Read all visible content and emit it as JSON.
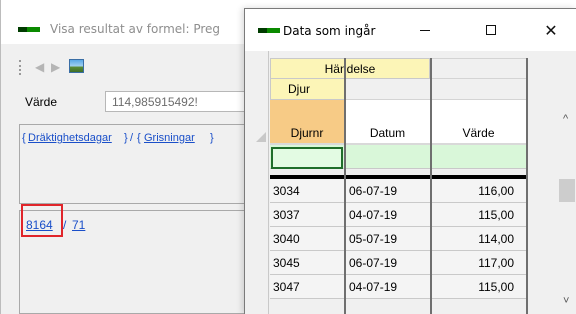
{
  "background_window": {
    "title": "Visa resultat av formel: Preg",
    "toolbar": {
      "back_icon": "arrow-left-icon",
      "forward_icon": "arrow-right-icon",
      "image_icon": "picture-icon"
    },
    "varde_label": "Värde",
    "varde_value": "114,985915492!",
    "formula": {
      "part1": "Dräktighetsdagar",
      "separator": "/",
      "part2": "Grisningar",
      "brace_open": "{",
      "brace_close": "}"
    },
    "result": {
      "numerator": "8164",
      "separator": "/",
      "denominator": "71"
    }
  },
  "data_window": {
    "title": "Data som ingår",
    "caption_buttons": {
      "minimize": "minimize-icon",
      "maximize": "maximize-icon",
      "close": "✕"
    },
    "group_header": "Händelse",
    "sub_header": "Djur",
    "columns": [
      "Djurnr",
      "Datum",
      "Värde"
    ],
    "rows": [
      {
        "djurnr": "3034",
        "datum": "06-07-19",
        "varde": "116,00"
      },
      {
        "djurnr": "3037",
        "datum": "04-07-19",
        "varde": "115,00"
      },
      {
        "djurnr": "3040",
        "datum": "05-07-19",
        "varde": "114,00"
      },
      {
        "djurnr": "3045",
        "datum": "06-07-19",
        "varde": "117,00"
      },
      {
        "djurnr": "3047",
        "datum": "04-07-19",
        "varde": "115,00"
      }
    ],
    "scroll": {
      "up": "^",
      "down": "˅"
    }
  },
  "colors": {
    "app_green": "#0a8a00",
    "header_yellow": "#fcf5b7",
    "header_orange": "#f7cb86",
    "filter_green": "#d9f7d9",
    "link_blue": "#1a4fc9",
    "highlight_red": "#e0252a"
  }
}
